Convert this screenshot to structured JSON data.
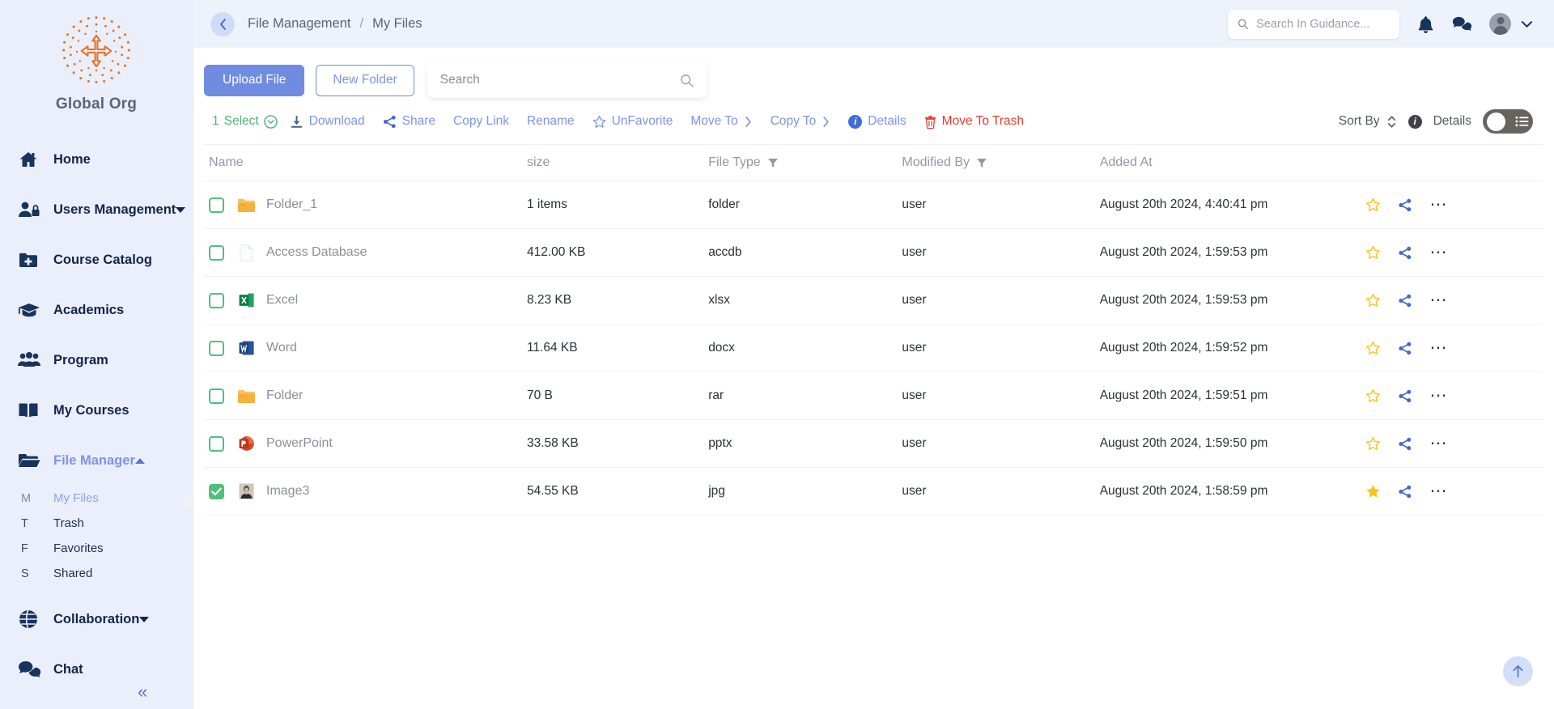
{
  "sidebar": {
    "brand": {
      "name": "Global Org",
      "logo_icon": "org-logo-icon"
    },
    "items": [
      {
        "label": "Home",
        "icon": "home-icon",
        "caret": null,
        "active": false
      },
      {
        "label": "Users Management",
        "icon": "users-lock-icon",
        "caret": "down",
        "active": false
      },
      {
        "label": "Course Catalog",
        "icon": "folder-plus-icon",
        "caret": null,
        "active": false
      },
      {
        "label": "Academics",
        "icon": "graduation-cap-icon",
        "caret": null,
        "active": false
      },
      {
        "label": "Program",
        "icon": "people-group-icon",
        "caret": null,
        "active": false
      },
      {
        "label": "My Courses",
        "icon": "open-book-icon",
        "caret": null,
        "active": false
      },
      {
        "label": "File Manager",
        "icon": "open-folder-icon",
        "caret": "up",
        "active": true
      }
    ],
    "subitems": [
      {
        "key": "M",
        "label": "My Files",
        "active": true
      },
      {
        "key": "T",
        "label": "Trash",
        "active": false
      },
      {
        "key": "F",
        "label": "Favorites",
        "active": false
      },
      {
        "key": "S",
        "label": "Shared",
        "active": false
      }
    ],
    "items_after": [
      {
        "label": "Collaboration",
        "icon": "globe-icon",
        "caret": "down",
        "active": false
      },
      {
        "label": "Chat",
        "icon": "chat-bubbles-icon",
        "caret": null,
        "active": false
      }
    ],
    "collapse_icon": "double-chevron-left-icon"
  },
  "topbar": {
    "back_icon": "chevron-left-icon",
    "breadcrumb": {
      "root": "File Management",
      "separator": "/",
      "current": "My Files"
    },
    "search": {
      "placeholder": "Search In Guidance...",
      "value": "",
      "icon": "search-icon"
    },
    "icons": [
      "bell-icon",
      "chat-bubbles-icon",
      "avatar",
      "chevron-down-icon"
    ]
  },
  "toolbar": {
    "upload_label": "Upload File",
    "new_folder_label": "New Folder",
    "search": {
      "placeholder": "Search",
      "value": "",
      "icon": "search-icon"
    }
  },
  "ops": {
    "select_count": "1",
    "select_label": "Select",
    "select_icon": "chevron-down-circle-icon",
    "actions": [
      {
        "label": "Download",
        "icon": "download-icon",
        "style": "link"
      },
      {
        "label": "Share",
        "icon": "share-icon",
        "style": "link"
      },
      {
        "label": "Copy Link",
        "icon": null,
        "style": "link"
      },
      {
        "label": "Rename",
        "icon": null,
        "style": "link"
      },
      {
        "label": "UnFavorite",
        "icon": "star-outline-icon",
        "style": "link"
      },
      {
        "label": "Move To",
        "icon": null,
        "trailing": "chevron-right-icon",
        "style": "link"
      },
      {
        "label": "Copy To",
        "icon": null,
        "trailing": "chevron-right-icon",
        "style": "link"
      },
      {
        "label": "Details",
        "icon": "info-icon",
        "style": "link"
      },
      {
        "label": "Move To Trash",
        "icon": "trash-icon",
        "style": "danger"
      }
    ],
    "sort_by_label": "Sort By",
    "sort_by_icon": "sort-updown-icon",
    "details_label": "Details",
    "details_icon": "info-icon",
    "view_toggle": {
      "state": "list",
      "icon": "list-view-icon"
    }
  },
  "table": {
    "columns": [
      {
        "label": "Name",
        "filter": false
      },
      {
        "label": "size",
        "filter": false
      },
      {
        "label": "File Type",
        "filter": true
      },
      {
        "label": "Modified By",
        "filter": true
      },
      {
        "label": "Added At",
        "filter": false
      },
      {
        "label": "",
        "filter": false
      }
    ],
    "rows": [
      {
        "selected": false,
        "icon": "folder-icon",
        "name": "Folder_1",
        "size": "1 items",
        "type": "folder",
        "modified_by": "user",
        "added_at": "August 20th 2024, 4:40:41 pm",
        "favorite": false
      },
      {
        "selected": false,
        "icon": "generic-file-icon",
        "name": "Access Database",
        "size": "412.00 KB",
        "type": "accdb",
        "modified_by": "user",
        "added_at": "August 20th 2024, 1:59:53 pm",
        "favorite": false
      },
      {
        "selected": false,
        "icon": "excel-icon",
        "name": "Excel",
        "size": "8.23 KB",
        "type": "xlsx",
        "modified_by": "user",
        "added_at": "August 20th 2024, 1:59:53 pm",
        "favorite": false
      },
      {
        "selected": false,
        "icon": "word-icon",
        "name": "Word",
        "size": "11.64 KB",
        "type": "docx",
        "modified_by": "user",
        "added_at": "August 20th 2024, 1:59:52 pm",
        "favorite": false
      },
      {
        "selected": false,
        "icon": "folder-icon",
        "name": "Folder",
        "size": "70 B",
        "type": "rar",
        "modified_by": "user",
        "added_at": "August 20th 2024, 1:59:51 pm",
        "favorite": false
      },
      {
        "selected": false,
        "icon": "powerpoint-icon",
        "name": "PowerPoint",
        "size": "33.58 KB",
        "type": "pptx",
        "modified_by": "user",
        "added_at": "August 20th 2024, 1:59:50 pm",
        "favorite": false
      },
      {
        "selected": true,
        "icon": "image-thumb-icon",
        "name": "Image3",
        "size": "54.55 KB",
        "type": "jpg",
        "modified_by": "user",
        "added_at": "August 20th 2024, 1:58:59 pm",
        "favorite": true
      }
    ],
    "row_actions": {
      "star_icon": "star-icon",
      "share_icon": "share-icon",
      "more_icon": "ellipsis-icon"
    }
  },
  "scroll_top": {
    "icon": "arrow-up-icon"
  },
  "colors": {
    "sidebar_bg": "#eaeffb",
    "accent_blue": "#6f8ce0",
    "link_blue": "#7e93e8",
    "green": "#4fc07a",
    "danger_red": "#e43b2e",
    "star_gold": "#f5c518",
    "brand_orange": "#e8732a"
  }
}
